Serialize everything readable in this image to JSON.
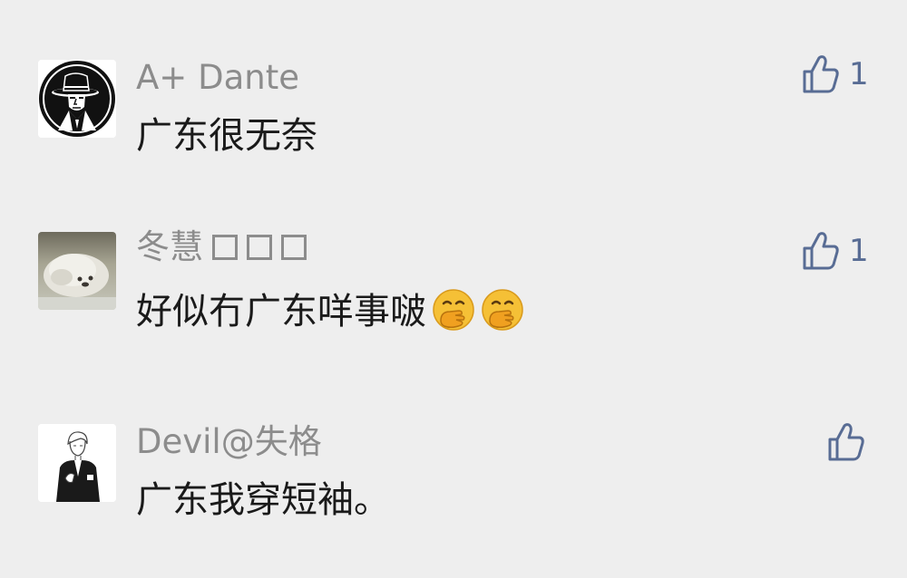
{
  "comments": [
    {
      "author": "A+ Dante",
      "author_boxes": [],
      "text": "广东很无奈",
      "likes": "1",
      "avatar_icon": "fedora-man-avatar-icon"
    },
    {
      "author": "冬慧",
      "author_boxes": [
        "□",
        "□",
        "□"
      ],
      "text": "好似冇广东咩事啵",
      "emojis": [
        "hand-over-mouth-emoji",
        "hand-over-mouth-emoji"
      ],
      "likes": "1",
      "avatar_icon": "white-dog-photo-avatar"
    },
    {
      "author": "Devil@失格",
      "author_boxes": [],
      "text": "广东我穿短袖。",
      "likes": "",
      "avatar_icon": "anime-boy-sketch-avatar"
    }
  ],
  "colors": {
    "background": "#eeeeee",
    "author": "#8c8c8c",
    "text": "#1a1a1a",
    "like_accent": "#586c94",
    "emoji": "#f5c036"
  }
}
